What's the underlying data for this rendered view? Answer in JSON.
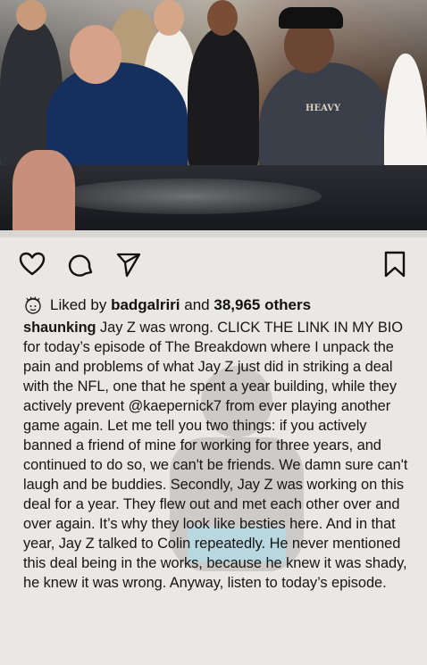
{
  "post": {
    "actions": {
      "like_icon": "heart-icon",
      "comment_icon": "comment-icon",
      "share_icon": "send-icon",
      "save_icon": "bookmark-icon"
    },
    "likes": {
      "prefix": "Liked by",
      "user": "badgalriri",
      "middle": "and",
      "count": "38,965 others"
    },
    "caption": {
      "username": "shaunking",
      "text": "Jay Z was wrong. CLICK THE LINK IN MY BIO for today’s episode of The Breakdown where I unpack the pain and problems of what Jay Z just did in striking a deal with the NFL, one that he spent a year building, while they actively prevent @kaepernick7 from ever playing another game again. Let me tell you two things: if you actively banned a friend of mine for working for three years, and continued to do so, we can't be friends. We damn sure can't laugh and be buddies. Secondly, Jay Z was working on this deal for a year. They flew out and met each other over and over again. It’s why they look like besties here. And in that year, Jay Z talked to Colin repeatedly. He never mentioned this deal being in the works, because he knew it was shady, he knew it was wrong. Anyway, listen to today’s episode."
    },
    "photo": {
      "hat_text": "HEAVY"
    }
  }
}
